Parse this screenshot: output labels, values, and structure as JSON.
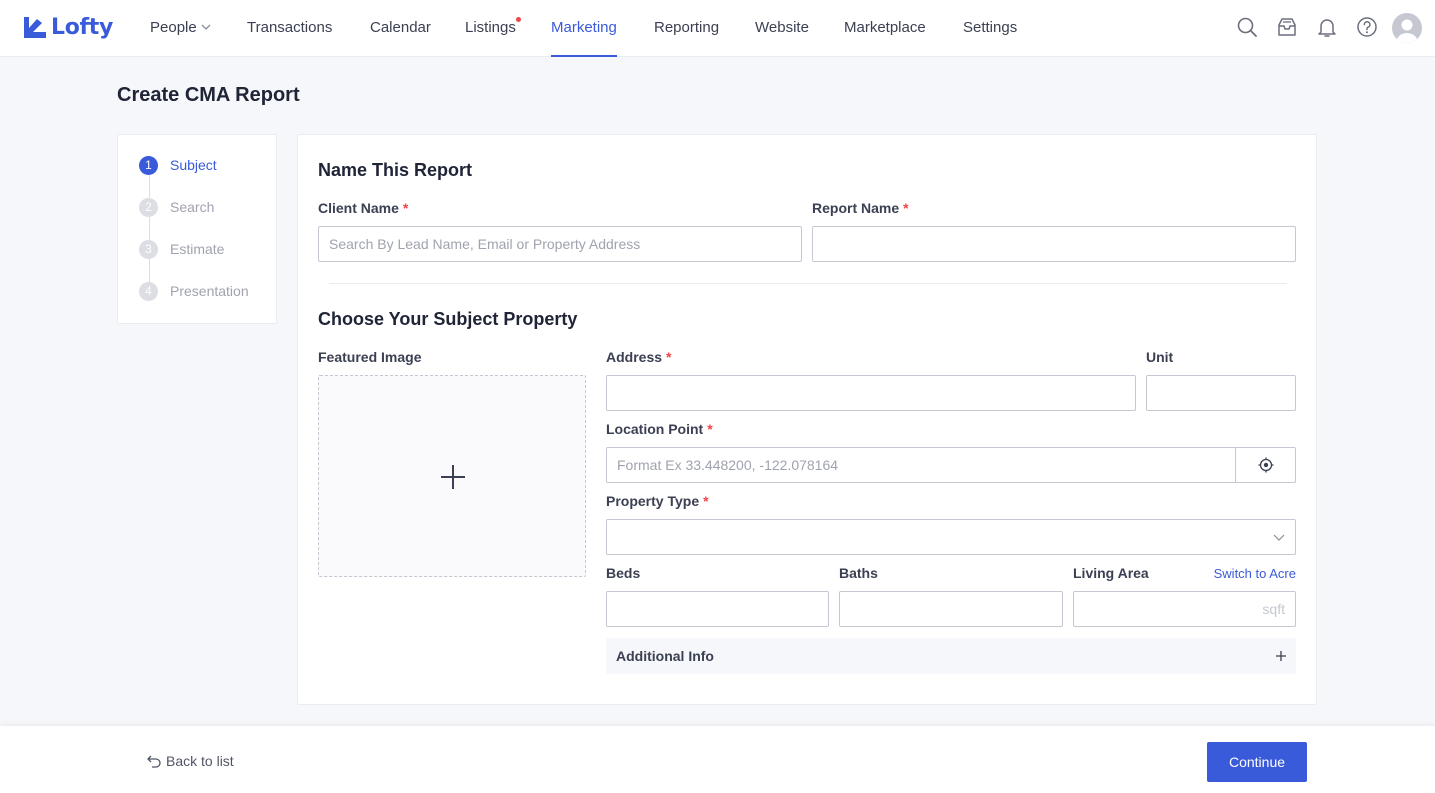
{
  "app": {
    "logo_text": "Lofty",
    "brand_color": "#3a5bd9"
  },
  "nav": {
    "items": [
      {
        "label": "People"
      },
      {
        "label": "Transactions"
      },
      {
        "label": "Calendar"
      },
      {
        "label": "Listings"
      },
      {
        "label": "Marketing"
      },
      {
        "label": "Reporting"
      },
      {
        "label": "Website"
      },
      {
        "label": "Marketplace"
      },
      {
        "label": "Settings"
      }
    ],
    "active": "Marketing",
    "icons": [
      "search-icon",
      "inbox-icon",
      "bell-icon",
      "help-icon",
      "avatar"
    ]
  },
  "page": {
    "title": "Create CMA Report"
  },
  "steps": [
    {
      "num": "1",
      "label": "Subject"
    },
    {
      "num": "2",
      "label": "Search"
    },
    {
      "num": "3",
      "label": "Estimate"
    },
    {
      "num": "4",
      "label": "Presentation"
    }
  ],
  "name_section": {
    "title": "Name This Report",
    "client_label": "Client Name",
    "client_placeholder": "Search By Lead Name, Email or Property Address",
    "report_label": "Report Name",
    "required_mark": "*"
  },
  "subject_section": {
    "title": "Choose Your Subject Property",
    "featured_image_label": "Featured Image",
    "address_label": "Address",
    "unit_label": "Unit",
    "location_label": "Location Point",
    "location_placeholder": "Format Ex 33.448200, -122.078164",
    "property_type_label": "Property Type",
    "beds_label": "Beds",
    "baths_label": "Baths",
    "living_area_label": "Living Area",
    "switch_link": "Switch to Acre",
    "area_unit": "sqft",
    "additional_info": "Additional Info"
  },
  "footer": {
    "back_label": "Back to list",
    "continue_label": "Continue"
  }
}
